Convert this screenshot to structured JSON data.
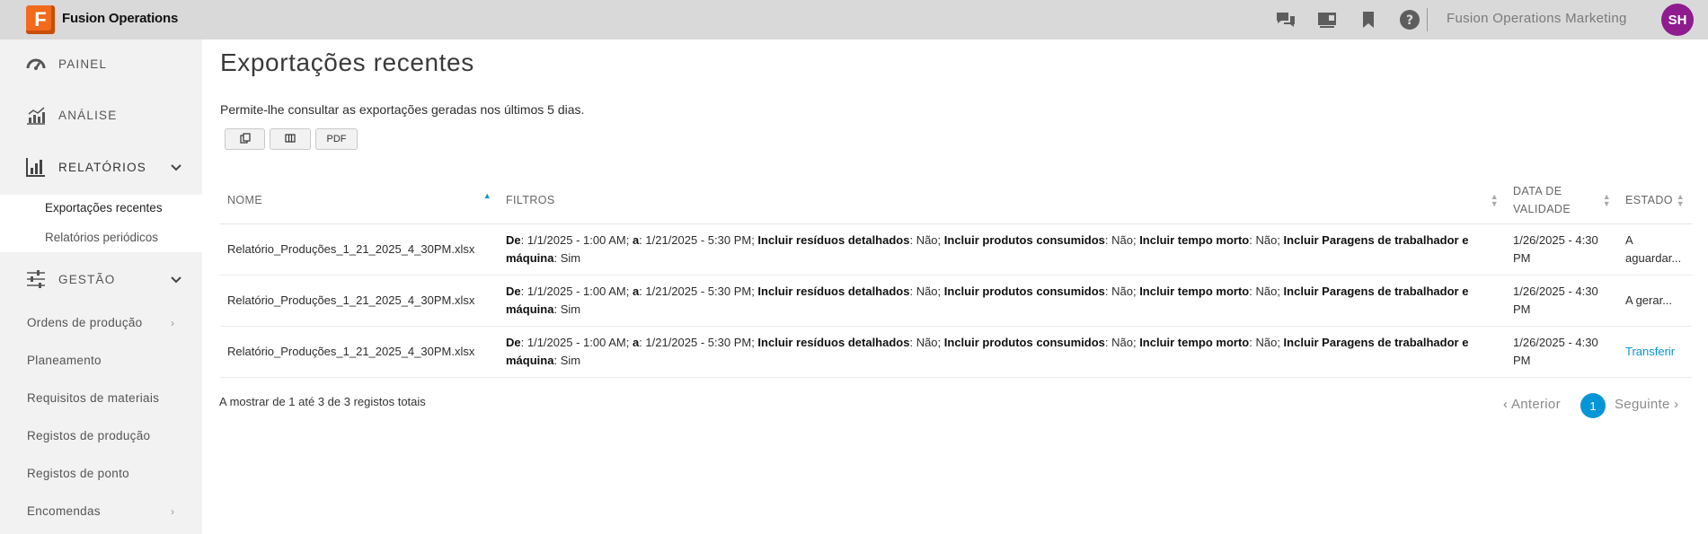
{
  "app": {
    "logo_letter": "F",
    "title": "Fusion Operations"
  },
  "header": {
    "icons": [
      "chat-icon",
      "presentation-icon",
      "bookmark-icon",
      "help-icon"
    ],
    "user_label": "Fusion Operations Marketing",
    "avatar_initials": "SH"
  },
  "sidebar": {
    "painel": "PAINEL",
    "analise": "ANÁLISE",
    "relatorios": "RELATÓRIOS",
    "relatorios_sub": [
      "Exportações recentes",
      "Relatórios periódicos"
    ],
    "gestao": "GESTÃO",
    "gestao_items": [
      "Ordens de produção",
      "Planeamento",
      "Requisitos de materiais",
      "Registos de produção",
      "Registos de ponto",
      "Encomendas"
    ]
  },
  "main": {
    "title": "Exportações recentes",
    "description": "Permite-lhe consultar as exportações geradas nos últimos 5 dias.",
    "toolbar": {
      "copy_icon": "copy-icon",
      "columns_icon": "columns-icon",
      "pdf_label": "PDF"
    },
    "table": {
      "headers": {
        "name": "NOME",
        "filters": "FILTROS",
        "validity": "DATA DE VALIDADE",
        "state": "ESTADO"
      },
      "rows": [
        {
          "name": "Relatório_Produções_1_21_2025_4_30PM.xlsx",
          "f_de_k": "De",
          "f_de_v": ": 1/1/2025 - 1:00 AM; ",
          "f_a_k": "a",
          "f_a_v": ": 1/21/2025 - 5:30 PM; ",
          "f_res_k": "Incluir resíduos detalhados",
          "f_res_v": ": Não; ",
          "f_prod_k": "Incluir produtos consumidos",
          "f_prod_v": ": Não; ",
          "f_morto_k": "Incluir tempo morto",
          "f_morto_v": ": Não; ",
          "f_par_k": "Incluir Paragens de trabalhador e máquina",
          "f_par_v": ": Sim",
          "validity": "1/26/2025 - 4:30 PM",
          "state": "A aguardar..."
        },
        {
          "name": "Relatório_Produções_1_21_2025_4_30PM.xlsx",
          "f_de_k": "De",
          "f_de_v": ": 1/1/2025 - 1:00 AM; ",
          "f_a_k": "a",
          "f_a_v": ": 1/21/2025 - 5:30 PM; ",
          "f_res_k": "Incluir resíduos detalhados",
          "f_res_v": ": Não; ",
          "f_prod_k": "Incluir produtos consumidos",
          "f_prod_v": ": Não; ",
          "f_morto_k": "Incluir tempo morto",
          "f_morto_v": ": Não; ",
          "f_par_k": "Incluir Paragens de trabalhador e máquina",
          "f_par_v": ": Sim",
          "validity": "1/26/2025 - 4:30 PM",
          "state": "A gerar..."
        },
        {
          "name": "Relatório_Produções_1_21_2025_4_30PM.xlsx",
          "f_de_k": "De",
          "f_de_v": ": 1/1/2025 - 1:00 AM; ",
          "f_a_k": "a",
          "f_a_v": ": 1/21/2025 - 5:30 PM; ",
          "f_res_k": "Incluir resíduos detalhados",
          "f_res_v": ": Não; ",
          "f_prod_k": "Incluir produtos consumidos",
          "f_prod_v": ": Não; ",
          "f_morto_k": "Incluir tempo morto",
          "f_morto_v": ": Não; ",
          "f_par_k": "Incluir Paragens de trabalhador e máquina",
          "f_par_v": ": Sim",
          "validity": "1/26/2025 - 4:30 PM",
          "state": "Transferir"
        }
      ]
    },
    "footer_info": "A mostrar de 1 até 3 de 3 registos totais",
    "pagination": {
      "prev": "Anterior",
      "current": "1",
      "next": "Seguinte"
    }
  },
  "colors": {
    "accent": "#0696d7",
    "logo": "#f26b1d",
    "avatar": "#8e1c8f",
    "topbar": "#d9d9d9",
    "sidebar": "#f2f2f2"
  }
}
